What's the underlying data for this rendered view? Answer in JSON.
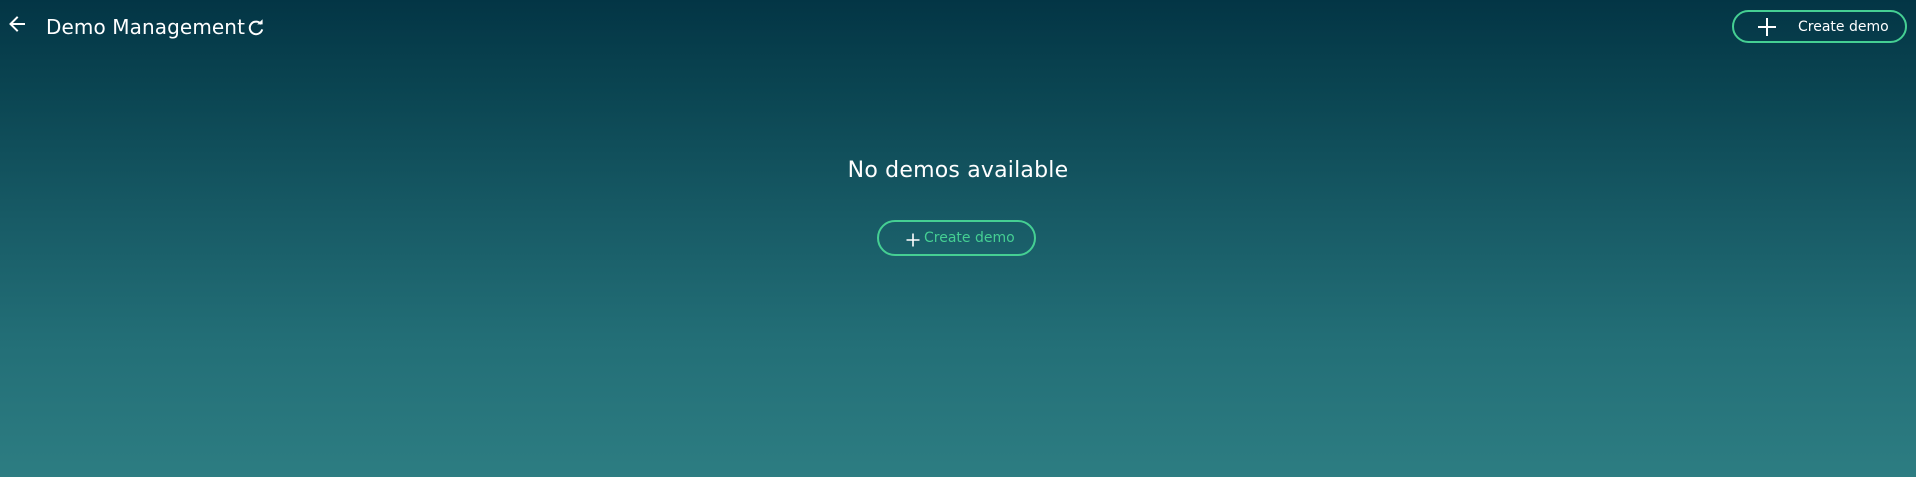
{
  "header": {
    "title": "Demo Management",
    "back_icon": "arrow-left-icon",
    "refresh_icon": "refresh-icon",
    "create_button_label": "Create demo"
  },
  "empty_state": {
    "message": "No demos available",
    "create_button_label": "Create demo"
  },
  "colors": {
    "accent": "#45cf93",
    "text": "#ffffff",
    "background_top": "#033545",
    "background_bottom": "#2d7d82"
  }
}
